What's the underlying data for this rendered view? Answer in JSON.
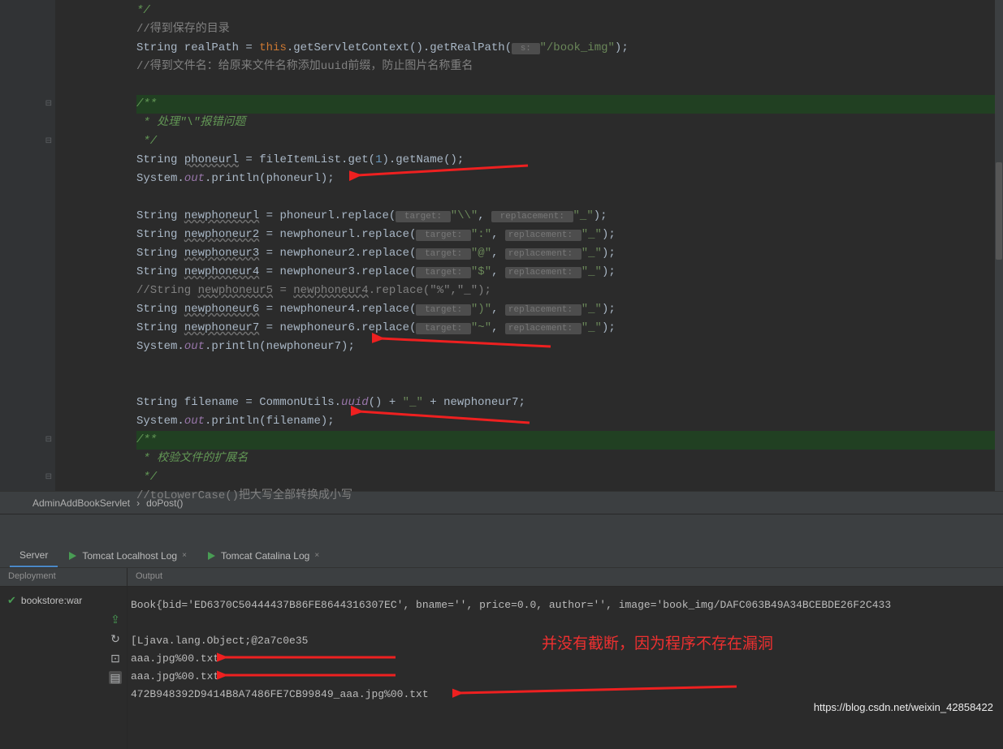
{
  "code": {
    "lines": [
      {
        "num": "",
        "content": "*/",
        "cls": "doc-comment",
        "indent": 0
      },
      {
        "num": "",
        "content": "//得到保存的目录",
        "cls": "comment",
        "indent": 0
      },
      {
        "num": "",
        "content_html": "String realPath = <kw>this</kw>.getServletContext().getRealPath(<hint> s: </hint><str>\"/book_img\"</str>);",
        "indent": 0
      },
      {
        "num": "",
        "content": "//得到文件名：给原来文件名称添加uuid前缀，防止图片名称重名",
        "cls": "comment",
        "indent": 0
      },
      {
        "num": "",
        "blank": true
      },
      {
        "num": "",
        "content": "/**",
        "cls": "doc-comment hl-green",
        "indent": 0
      },
      {
        "num": "",
        "content": " * 处理\"\\\"报错问题",
        "cls": "doc-comment",
        "indent": 0
      },
      {
        "num": "",
        "content": " */",
        "cls": "doc-comment",
        "indent": 0
      },
      {
        "num": "",
        "content_html": "String <u>phoneurl</u> = fileItemList.get(<num>1</num>).getName();",
        "indent": 0
      },
      {
        "num": "",
        "content_html": "System.<stat>out</stat>.println(phoneurl);",
        "indent": 0
      },
      {
        "num": "",
        "blank": true
      },
      {
        "num": "",
        "content_html": "String <u>newphoneurl</u> = phoneurl.replace(<hint> target: </hint><str>\"\\\\\"</str>, <hint> replacement: </hint><str>\"_\"</str>);",
        "indent": 0
      },
      {
        "num": "",
        "content_html": "String <u>newphoneur2</u> = newphoneurl.replace(<hint> target: </hint><str>\":\"</str>, <hint>replacement: </hint><str>\"_\"</str>);",
        "indent": 0
      },
      {
        "num": "",
        "content_html": "String <u>newphoneur3</u> = newphoneur2.replace(<hint> target: </hint><str>\"@\"</str>, <hint>replacement: </hint><str>\"_\"</str>);",
        "indent": 0
      },
      {
        "num": "",
        "content_html": "String <u>newphoneur4</u> = newphoneur3.replace(<hint> target: </hint><str>\"$\"</str>, <hint>replacement: </hint><str>\"_\"</str>);",
        "indent": 0
      },
      {
        "num": "",
        "content_html": "//String <u>newphoneur5</u> = <u>newphoneur4</u>.replace(\"%\",\"_\");",
        "cls": "comment",
        "indent": 0
      },
      {
        "num": "",
        "content_html": "String <u>newphoneur6</u> = newphoneur4.replace(<hint> target: </hint><str>\")\"</str>, <hint>replacement: </hint><str>\"_\"</str>);",
        "indent": 0
      },
      {
        "num": "",
        "content_html": "String <u>newphoneur7</u> = newphoneur6.replace(<hint> target: </hint><str>\"~\"</str>, <hint>replacement: </hint><str>\"_\"</str>);",
        "indent": 0
      },
      {
        "num": "",
        "content_html": "System.<stat>out</stat>.println(newphoneur7);",
        "indent": 0
      },
      {
        "num": "",
        "blank": true
      },
      {
        "num": "",
        "blank": true
      },
      {
        "num": "",
        "content_html": "String filename = CommonUtils.<stat>uuid</stat>() + <str>\"_\"</str> + newphoneur7;",
        "indent": 0
      },
      {
        "num": "",
        "content_html": "System.<stat>out</stat>.println(filename);",
        "indent": 0
      },
      {
        "num": "",
        "content": "/**",
        "cls": "doc-comment hl-green",
        "indent": 0,
        "highlighted": true
      },
      {
        "num": "",
        "content": " * 校验文件的扩展名",
        "cls": "doc-comment",
        "indent": 0
      },
      {
        "num": "",
        "content": " */",
        "cls": "doc-comment",
        "indent": 0
      },
      {
        "num": "",
        "content": "//toLowerCase()把大写全部转换成小写",
        "cls": "comment",
        "indent": 0
      }
    ]
  },
  "breadcrumb": {
    "class": "AdminAddBookServlet",
    "method": "doPost()"
  },
  "panel": {
    "tabs": [
      "Server",
      "Tomcat Localhost Log",
      "Tomcat Catalina Log"
    ],
    "headers": {
      "left": "Deployment",
      "right": "Output"
    },
    "deploy_item": "bookstore:war",
    "output_lines": [
      "Book{bid='ED6370C50444437B86FE8644316307EC', bname='', price=0.0, author='', image='book_img/DAFC063B49A34BCEBDE26F2C433",
      "",
      "[Ljava.lang.Object;@2a7c0e35",
      "aaa.jpg%00.txt",
      "aaa.jpg%00.txt",
      "472B948392D9414B8A7486FE7CB99849_aaa.jpg%00.txt"
    ]
  },
  "annotation": "并没有截断，因为程序不存在漏洞",
  "watermark": "https://blog.csdn.net/weixin_42858422"
}
